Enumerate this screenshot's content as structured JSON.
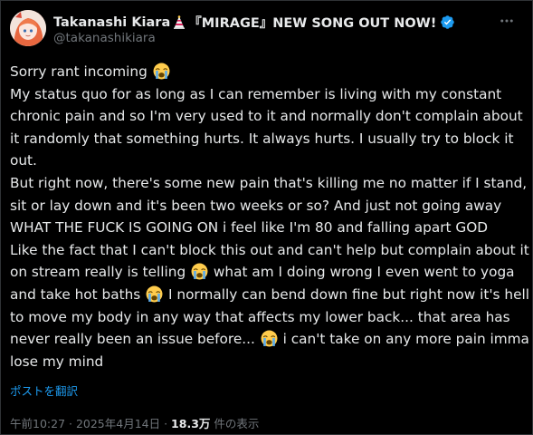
{
  "user": {
    "display_name": "Takanashi Kiara",
    "title_suffix": "『MIRAGE』NEW SONG OUT NOW!",
    "handle": "@takanashikiara"
  },
  "post": {
    "lines": [
      "Sorry rant incoming",
      "My status quo for as long as I can remember is living with my constant",
      "chronic pain and so I'm very used to it and normally don't complain about",
      "it randomly that something hurts. It always hurts. I usually try to block it",
      "out.",
      "But right now, there's some new pain that's killing me no matter if I stand,",
      "sit or lay down and it's been two weeks or so? And just not going away",
      "WHAT THE FUCK IS GOING ON i feel like I'm 80 and falling apart GOD",
      "Like the fact that I can't block this out and can't help but complain about it",
      "on stream really is telling",
      " what am I doing wrong I even went to yoga",
      "and take hot baths",
      " I normally can bend down fine but right now it's hell",
      "to move my body in any way that affects my lower back... that area has",
      "never really been an issue before...",
      " i can't take on any more pain imma",
      "lose my mind"
    ],
    "translate_label": "ポストを翻訳"
  },
  "meta": {
    "time": "午前10:27",
    "separator": " · ",
    "date": "2025年4月14日",
    "separator2": " · ",
    "views": "18.3万",
    "views_label": " 件の表示"
  },
  "icons": {
    "verified": "verified-badge-icon",
    "more": "more-options-icon",
    "emoji": "loudly-crying-face-emoji",
    "hat": "party-hat-emoji"
  },
  "colors": {
    "background": "#000000",
    "text": "#e7e9ea",
    "secondary": "#71767b",
    "link": "#1d9bf0",
    "verified": "#1d9bf0"
  }
}
